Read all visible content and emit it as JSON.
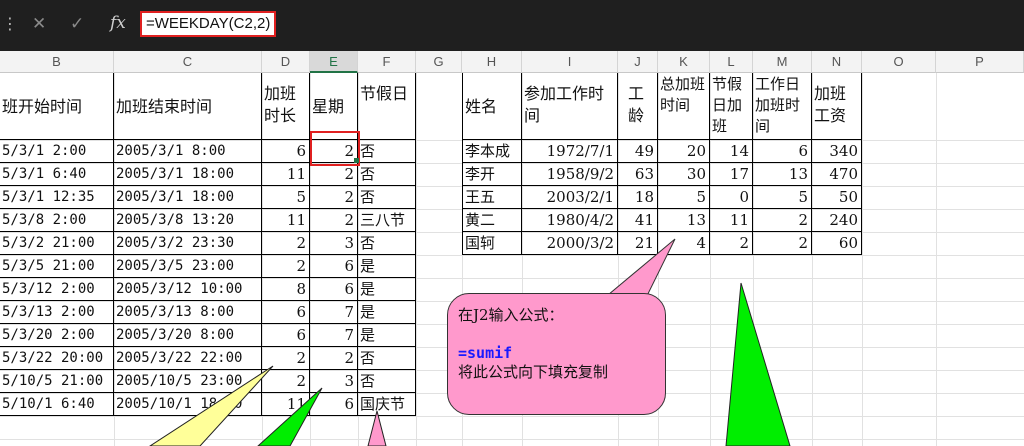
{
  "formula_bar": {
    "formula": "=WEEKDAY(C2,2)",
    "cancel_glyph": "✕",
    "confirm_glyph": "✓",
    "fx_label": "fx",
    "dots": "⋮"
  },
  "columns": [
    "B",
    "C",
    "D",
    "E",
    "F",
    "G",
    "H",
    "I",
    "J",
    "K",
    "L",
    "M",
    "N",
    "O",
    "P"
  ],
  "selected_column": "E",
  "left_table": {
    "headers": {
      "b": "班开始时间",
      "c": "加班结束时间",
      "d": "加班时长",
      "e": "星期",
      "f": "节假日"
    },
    "rows": [
      {
        "b": "5/3/1 2:00",
        "c": "2005/3/1 8:00",
        "d": "6",
        "e": "2",
        "f": "否"
      },
      {
        "b": "5/3/1 6:40",
        "c": "2005/3/1 18:00",
        "d": "11",
        "e": "2",
        "f": "否"
      },
      {
        "b": "5/3/1 12:35",
        "c": "2005/3/1 18:00",
        "d": "5",
        "e": "2",
        "f": "否"
      },
      {
        "b": "5/3/8 2:00",
        "c": "2005/3/8 13:20",
        "d": "11",
        "e": "2",
        "f": "三八节"
      },
      {
        "b": "5/3/2 21:00",
        "c": "2005/3/2 23:30",
        "d": "2",
        "e": "3",
        "f": "否"
      },
      {
        "b": "5/3/5 21:00",
        "c": "2005/3/5 23:00",
        "d": "2",
        "e": "6",
        "f": "是"
      },
      {
        "b": "5/3/12 2:00",
        "c": "2005/3/12 10:00",
        "d": "8",
        "e": "6",
        "f": "是"
      },
      {
        "b": "5/3/13 2:00",
        "c": "2005/3/13 8:00",
        "d": "6",
        "e": "7",
        "f": "是"
      },
      {
        "b": "5/3/20 2:00",
        "c": "2005/3/20 8:00",
        "d": "6",
        "e": "7",
        "f": "是"
      },
      {
        "b": "5/3/22 20:00",
        "c": "2005/3/22 22:00",
        "d": "2",
        "e": "2",
        "f": "否"
      },
      {
        "b": "5/10/5 21:00",
        "c": "2005/10/5 23:00",
        "d": "2",
        "e": "3",
        "f": "否"
      },
      {
        "b": "5/10/1 6:40",
        "c": "2005/10/1 18:00",
        "d": "11",
        "e": "6",
        "f": "国庆节"
      }
    ]
  },
  "right_table": {
    "headers": {
      "h": "姓名",
      "i": "参加工作时间",
      "j": "工龄",
      "k": "总加班时间",
      "l": "节假日加班",
      "m": "工作日加班时间",
      "n": "加班工资"
    },
    "rows": [
      {
        "h": "李本成",
        "i": "1972/7/1",
        "j": "49",
        "k": "20",
        "l": "14",
        "m": "6",
        "n": "340"
      },
      {
        "h": "李开",
        "i": "1958/9/2",
        "j": "63",
        "k": "30",
        "l": "17",
        "m": "13",
        "n": "470"
      },
      {
        "h": "王五",
        "i": "2003/2/1",
        "j": "18",
        "k": "5",
        "l": "0",
        "m": "5",
        "n": "50"
      },
      {
        "h": "黄二",
        "i": "1980/4/2",
        "j": "41",
        "k": "13",
        "l": "11",
        "m": "2",
        "n": "240"
      },
      {
        "h": "国轲",
        "i": "2000/3/2",
        "j": "21",
        "k": "4",
        "l": "2",
        "m": "2",
        "n": "60"
      }
    ]
  },
  "callout": {
    "line1": "在J2输入公式：",
    "line2": "=sumif",
    "line3": "将此公式向下填充复制",
    "fill_color": "#ff99cc",
    "text_blue": "#1a1aff"
  },
  "colors": {
    "selection_red": "#e02020",
    "green_shape": "#00ee00",
    "yellow_shape": "#ffff99",
    "pink_shape": "#ff99cc"
  }
}
